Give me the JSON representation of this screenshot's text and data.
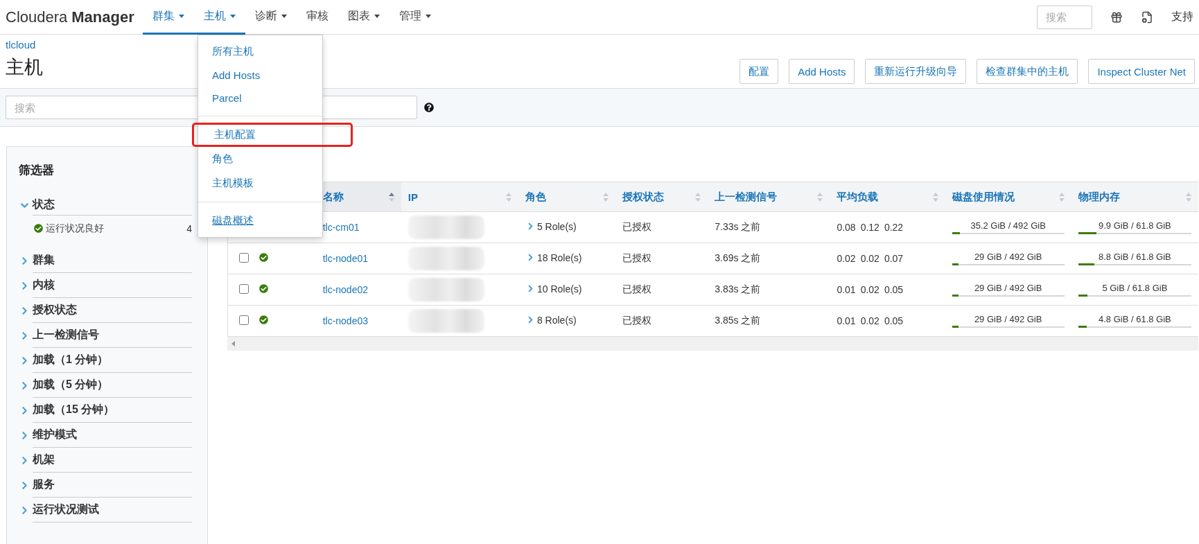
{
  "navbar": {
    "brand": "Cloudera",
    "brand_bold": "Manager",
    "menus": [
      {
        "label": "群集",
        "caret": true,
        "selected": true
      },
      {
        "label": "主机",
        "caret": true,
        "selected": true
      },
      {
        "label": "诊断",
        "caret": true,
        "selected": false
      },
      {
        "label": "审核",
        "caret": false,
        "selected": false
      },
      {
        "label": "图表",
        "caret": true,
        "selected": false
      },
      {
        "label": "管理",
        "caret": true,
        "selected": false
      }
    ],
    "search": {
      "placeholder": "搜索"
    },
    "support": "支持"
  },
  "dropdown": {
    "groups": [
      [
        {
          "label": "所有主机",
          "annotated": false,
          "hovered": false
        },
        {
          "label": "Add Hosts",
          "annotated": false,
          "hovered": false
        },
        {
          "label": "Parcel",
          "annotated": false,
          "hovered": false
        }
      ],
      [
        {
          "label": "主机配置",
          "annotated": true,
          "hovered": false
        },
        {
          "label": "角色",
          "annotated": false,
          "hovered": false
        },
        {
          "label": "主机模板",
          "annotated": false,
          "hovered": false
        }
      ],
      [
        {
          "label": "磁盘概述",
          "annotated": false,
          "hovered": true
        }
      ]
    ]
  },
  "breadcrumb": "tlcloud",
  "title": "主机",
  "actions": [
    "配置",
    "Add Hosts",
    "重新运行升级向导",
    "检查群集中的主机",
    "Inspect Cluster Net"
  ],
  "search": {
    "placeholder": "搜索"
  },
  "filters": {
    "title": "筛选器",
    "sections": [
      {
        "label": "状态",
        "expanded": true,
        "children": [
          {
            "label": "运行状况良好",
            "healthy": true,
            "count": "4"
          }
        ]
      },
      {
        "label": "群集",
        "expanded": false
      },
      {
        "label": "内核",
        "expanded": false
      },
      {
        "label": "授权状态",
        "expanded": false
      },
      {
        "label": "上一检测信号",
        "expanded": false
      },
      {
        "label": "加载（1 分钟）",
        "expanded": false
      },
      {
        "label": "加载（5 分钟）",
        "expanded": false
      },
      {
        "label": "加载（15 分钟）",
        "expanded": false
      },
      {
        "label": "维护模式",
        "expanded": false
      },
      {
        "label": "机架",
        "expanded": false
      },
      {
        "label": "服务",
        "expanded": false
      },
      {
        "label": "运行状况测试",
        "expanded": false
      }
    ]
  },
  "table": {
    "columns": [
      {
        "label": "名称",
        "sorted": true
      },
      {
        "label": "IP",
        "sorted": false
      },
      {
        "label": "角色",
        "sorted": false
      },
      {
        "label": "授权状态",
        "sorted": false
      },
      {
        "label": "上一检测信号",
        "sorted": false
      },
      {
        "label": "平均负载",
        "sorted": false
      },
      {
        "label": "磁盘使用情况",
        "sorted": false
      },
      {
        "label": "物理内存",
        "sorted": false
      }
    ],
    "rows": [
      {
        "name": "tlc-cm01",
        "ip_redacted": true,
        "roles": "5 Role(s)",
        "auth": "已授权",
        "heartbeat": "7.33s 之前",
        "load": [
          "0.08",
          "0.12",
          "0.22"
        ],
        "disk": {
          "reading": "35.2 GiB / 492 GiB",
          "level": 0.072
        },
        "memory": {
          "reading": "9.9 GiB / 61.8 GiB",
          "level": 0.16
        }
      },
      {
        "checked": false,
        "healthy": true,
        "name": "tlc-node01",
        "ip_redacted": true,
        "roles": "18 Role(s)",
        "auth": "已授权",
        "heartbeat": "3.69s 之前",
        "load": [
          "0.02",
          "0.02",
          "0.07"
        ],
        "disk": {
          "reading": "29 GiB / 492 GiB",
          "level": 0.059
        },
        "memory": {
          "reading": "8.8 GiB / 61.8 GiB",
          "level": 0.142
        }
      },
      {
        "checked": false,
        "healthy": true,
        "name": "tlc-node02",
        "ip_redacted": true,
        "roles": "10 Role(s)",
        "auth": "已授权",
        "heartbeat": "3.83s 之前",
        "load": [
          "0.01",
          "0.02",
          "0.05"
        ],
        "disk": {
          "reading": "29 GiB / 492 GiB",
          "level": 0.059
        },
        "memory": {
          "reading": "5 GiB / 61.8 GiB",
          "level": 0.081
        }
      },
      {
        "checked": false,
        "healthy": true,
        "name": "tlc-node03",
        "ip_redacted": true,
        "roles": "8 Role(s)",
        "auth": "已授权",
        "heartbeat": "3.85s 之前",
        "load": [
          "0.01",
          "0.02",
          "0.05"
        ],
        "disk": {
          "reading": "29 GiB / 492 GiB",
          "level": 0.059
        },
        "memory": {
          "reading": "4.8 GiB / 61.8 GiB",
          "level": 0.078
        }
      }
    ]
  }
}
